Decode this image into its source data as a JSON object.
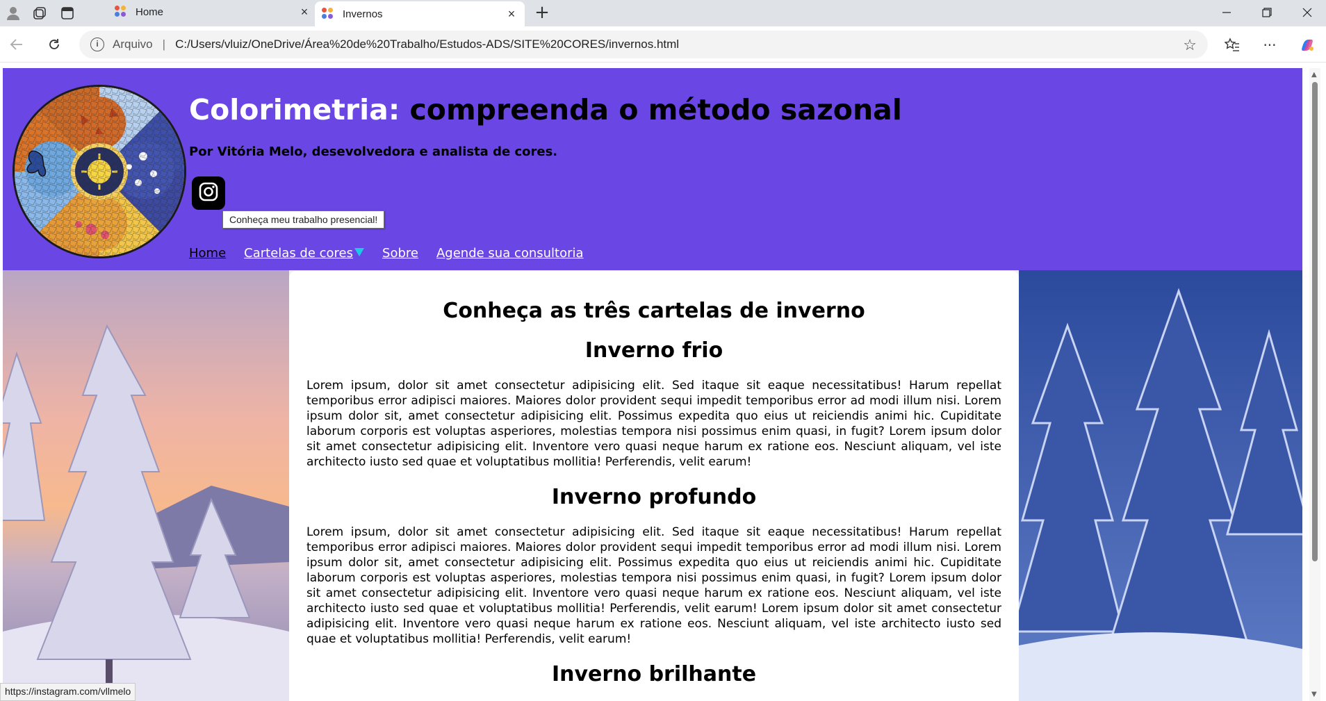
{
  "browser": {
    "tabs": [
      {
        "title": "Home",
        "active": false
      },
      {
        "title": "Invernos",
        "active": true
      }
    ],
    "address": {
      "protocol_label": "Arquivo",
      "url": "C:/Users/vluiz/OneDrive/Área%20de%20Trabalho/Estudos-ADS/SITE%20CORES/invernos.html"
    },
    "status_url": "https://instagram.com/vllmelo"
  },
  "header": {
    "title_brand": "Colorimetria:",
    "title_rest": " compreenda o método sazonal",
    "byline": "Por Vitória Melo, desevolvedora e analista de cores.",
    "tooltip": "Conheça meu trabalho presencial!",
    "nav": {
      "home": "Home",
      "cartelas": "Cartelas de cores",
      "sobre": "Sobre",
      "agende": "Agende sua consultoria"
    }
  },
  "main": {
    "heading": "Conheça as três cartelas de inverno",
    "sections": [
      {
        "title": "Inverno frio",
        "text": "Lorem ipsum, dolor sit amet consectetur adipisicing elit. Sed itaque sit eaque necessitatibus! Harum repellat temporibus error adipisci maiores. Maiores dolor provident sequi impedit temporibus error ad modi illum nisi. Lorem ipsum dolor sit, amet consectetur adipisicing elit. Possimus expedita quo eius ut reiciendis animi hic. Cupiditate laborum corporis est voluptas asperiores, molestias tempora nisi possimus enim quasi, in fugit? Lorem ipsum dolor sit amet consectetur adipisicing elit. Inventore vero quasi neque harum ex ratione eos. Nesciunt aliquam, vel iste architecto iusto sed quae et voluptatibus mollitia! Perferendis, velit earum!"
      },
      {
        "title": "Inverno profundo",
        "text": "Lorem ipsum, dolor sit amet consectetur adipisicing elit. Sed itaque sit eaque necessitatibus! Harum repellat temporibus error adipisci maiores. Maiores dolor provident sequi impedit temporibus error ad modi illum nisi. Lorem ipsum dolor sit, amet consectetur adipisicing elit. Possimus expedita quo eius ut reiciendis animi hic. Cupiditate laborum corporis est voluptas asperiores, molestias tempora nisi possimus enim quasi, in fugit? Lorem ipsum dolor sit amet consectetur adipisicing elit. Inventore vero quasi neque harum ex ratione eos. Nesciunt aliquam, vel iste architecto iusto sed quae et voluptatibus mollitia! Perferendis, velit earum! Lorem ipsum dolor sit amet consectetur adipisicing elit. Inventore vero quasi neque harum ex ratione eos. Nesciunt aliquam, vel iste architecto iusto sed quae et voluptatibus mollitia! Perferendis, velit earum!"
      },
      {
        "title": "Inverno brilhante"
      }
    ]
  },
  "colors": {
    "header_bg": "#6a46e4",
    "dropdown_caret": "#1ec9e8"
  },
  "icons": [
    "profile-icon",
    "workspaces-icon",
    "tab-actions-icon",
    "back-arrow-icon",
    "refresh-icon",
    "info-icon",
    "star-icon",
    "favorites-icon",
    "more-icon",
    "copilot-icon",
    "instagram-icon"
  ]
}
